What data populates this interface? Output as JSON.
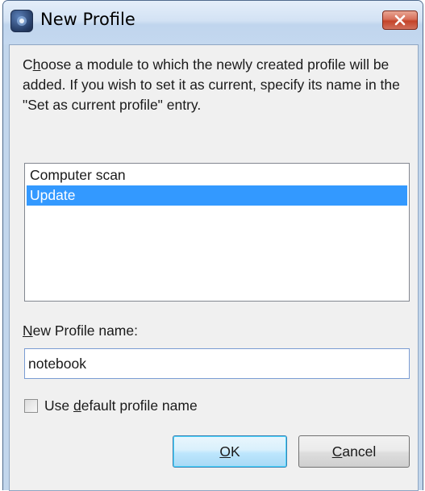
{
  "window": {
    "title": "New Profile",
    "icon": "app-shield-icon",
    "close_icon": "close-icon"
  },
  "description": "Choose a module to which the newly created profile will be added. If you wish to set it as current, specify its name in the \"Set as current profile\" entry.",
  "module_list": {
    "items": [
      {
        "label": "Computer scan",
        "selected": false
      },
      {
        "label": "Update",
        "selected": true
      }
    ]
  },
  "profile_name": {
    "label": "New Profile name:",
    "value": "notebook"
  },
  "default_name_checkbox": {
    "label": "Use default profile name",
    "checked": false
  },
  "buttons": {
    "ok": "OK",
    "cancel": "Cancel"
  },
  "colors": {
    "selection": "#3399ff",
    "close_button": "#c4442a"
  }
}
